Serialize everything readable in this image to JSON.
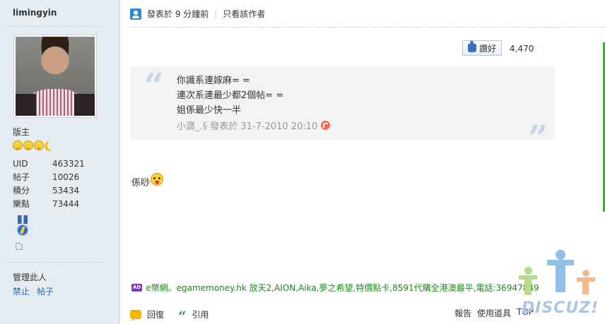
{
  "sidebar": {
    "username": "limingyin",
    "rank": "版主",
    "stats": [
      {
        "label": "UID",
        "value": "463321"
      },
      {
        "label": "帖子",
        "value": "10026"
      },
      {
        "label": "積分",
        "value": "53434"
      },
      {
        "label": "樂點",
        "value": "73444"
      }
    ],
    "manage_label": "管理此人",
    "actions": [
      "禁止",
      "帖子"
    ]
  },
  "post": {
    "time_text": "發表於 9 分鐘前",
    "author_only": "只看該作者",
    "like_label": "讚好",
    "like_count": "4,470",
    "quote": {
      "lines": [
        "你識系連嫁麻= =",
        "連次系連最少都2個帖= =",
        "姐係最少快一半"
      ],
      "meta": "小潺_.§ 發表於 31-7-2010 20:10"
    },
    "reply_text": "係唦",
    "ad_tag": "AD",
    "ad_text": "e幣網。egamemoney.hk 放天2,AION,Aika,夢之希望,特價點卡,8591代購全港澳最平,電話:36947849"
  },
  "bottom": {
    "reply_label": "回復",
    "quote_label": "引用",
    "report_label": "報告",
    "tools_label": "使用道具",
    "top_label": "TOP"
  },
  "watermark": {
    "text": "DISCUZ!"
  },
  "colors": {
    "sidebar_bg": "#e5edf2",
    "link": "#336699",
    "ad_green": "#1a8a1a",
    "quote_bg": "#f3f3f3"
  }
}
